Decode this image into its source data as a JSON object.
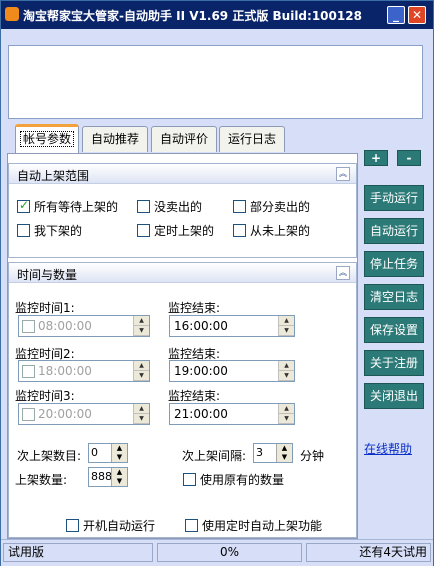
{
  "window": {
    "title": "淘宝帮家宝大管家-自动助手 II V1.69 正式版  Build:100128",
    "minimize": "_",
    "close": "✕"
  },
  "tabs": [
    {
      "label": "帐号参数",
      "active": true
    },
    {
      "label": "自动推荐",
      "active": false
    },
    {
      "label": "自动评价",
      "active": false
    },
    {
      "label": "运行日志",
      "active": false
    }
  ],
  "controls": {
    "plus": "+",
    "minus": "-"
  },
  "scope_group": {
    "title": "自动上架范围",
    "collapse": "︽",
    "options": [
      {
        "label": "所有等待上架的",
        "checked": true
      },
      {
        "label": "没卖出的",
        "checked": false
      },
      {
        "label": "部分卖出的",
        "checked": false
      },
      {
        "label": "我下架的",
        "checked": false
      },
      {
        "label": "定时上架的",
        "checked": false
      },
      {
        "label": "从未上架的",
        "checked": false
      }
    ]
  },
  "time_group": {
    "title": "时间与数量",
    "collapse": "︽",
    "monitors": [
      {
        "start_label": "监控时间1:",
        "start_value": "08:00:00",
        "end_label": "监控结束:",
        "end_value": "16:00:00"
      },
      {
        "start_label": "监控时间2:",
        "start_value": "18:00:00",
        "end_label": "监控结束:",
        "end_value": "19:00:00"
      },
      {
        "start_label": "监控时间3:",
        "start_value": "20:00:00",
        "end_label": "监控结束:",
        "end_value": "21:00:00"
      }
    ],
    "times_label": "次上架数目:",
    "times_value": "0",
    "interval_label": "次上架间隔:",
    "interval_value": "3",
    "interval_unit": "分钟",
    "qty_label": "上架数量:",
    "qty_value": "888",
    "use_original": "使用原有的数量",
    "startup_run": "开机自动运行",
    "use_timed": "使用定时自动上架功能"
  },
  "side_buttons": [
    "手动运行",
    "自动运行",
    "停止任务",
    "清空日志",
    "保存设置",
    "关于注册",
    "关闭退出"
  ],
  "help_link": "在线帮助",
  "status": {
    "left": "试用版",
    "progress": "0%",
    "right": "还有4天试用"
  }
}
